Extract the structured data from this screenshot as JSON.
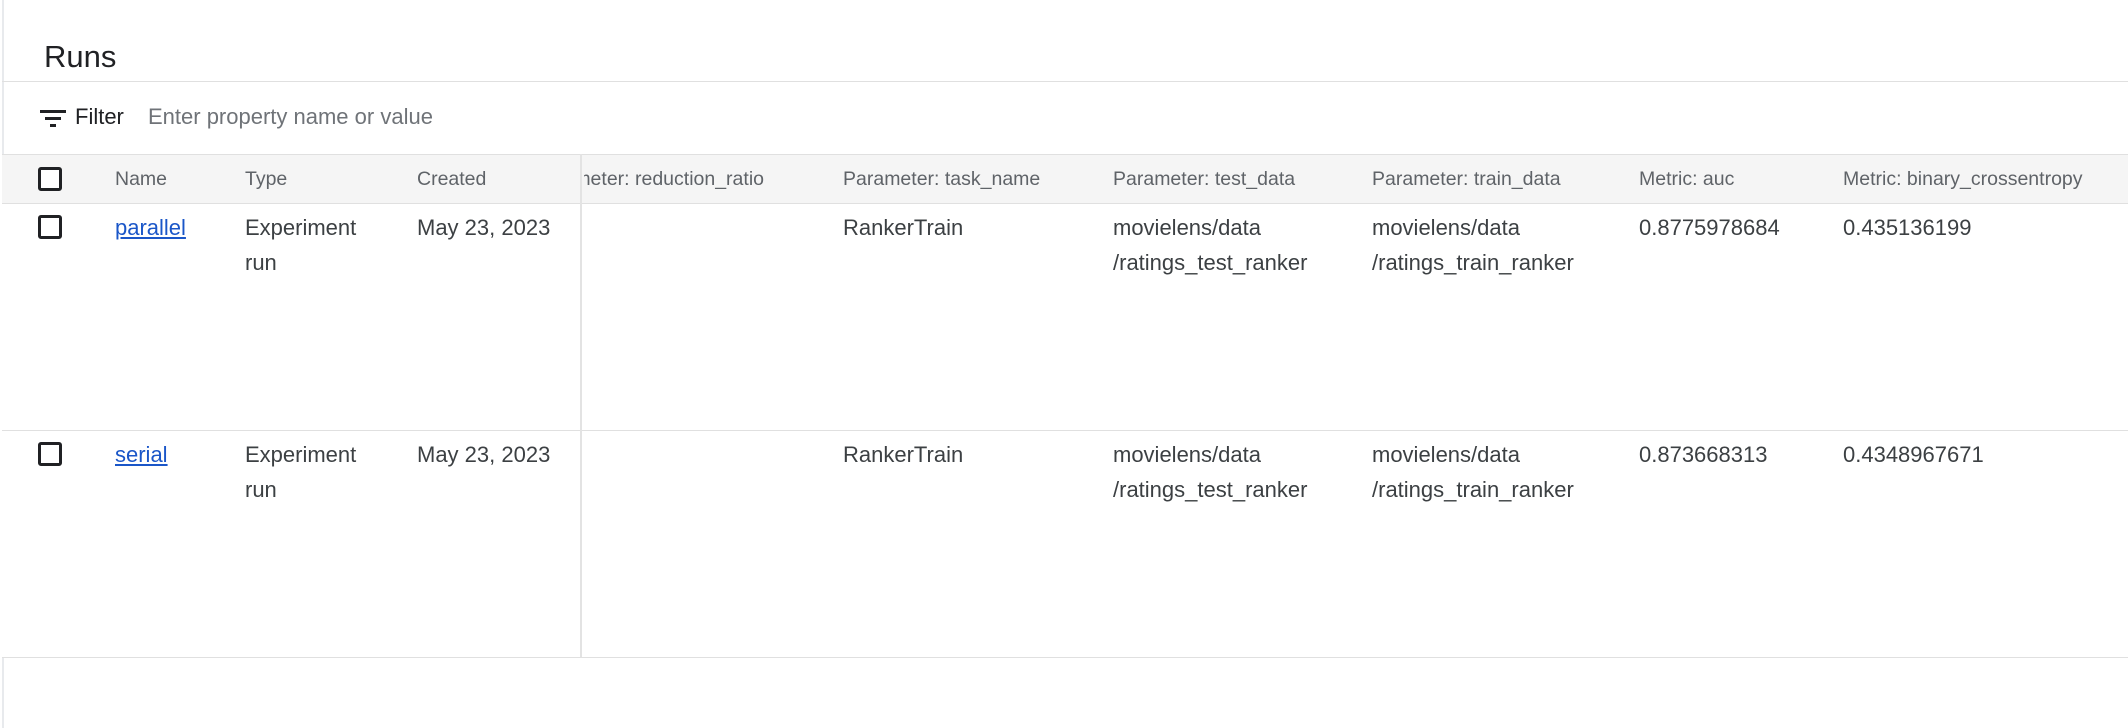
{
  "page": {
    "title": "Runs"
  },
  "filter": {
    "label": "Filter",
    "placeholder": "Enter property name or value",
    "icon": "filter-list-icon"
  },
  "table": {
    "columns": {
      "name": "Name",
      "type": "Type",
      "created": "Created",
      "reduction_ratio": "Parameter: reduction_ratio",
      "task_name": "Parameter: task_name",
      "test_data": "Parameter: test_data",
      "train_data": "Parameter: train_data",
      "auc": "Metric: auc",
      "binary_crossentropy": "Metric: binary_crossentropy"
    },
    "rows": [
      {
        "name": "parallel",
        "type": "Experiment run",
        "created": "May 23, 2023",
        "reduction_ratio": "",
        "task_name": "RankerTrain",
        "test_data": "movielens/data /ratings_test_ranker",
        "train_data": "movielens/data /ratings_train_ranker",
        "auc": "0.8775978684",
        "binary_crossentropy": "0.435136199"
      },
      {
        "name": "serial",
        "type": "Experiment run",
        "created": "May 23, 2023",
        "reduction_ratio": "",
        "task_name": "RankerTrain",
        "test_data": "movielens/data /ratings_test_ranker",
        "train_data": "movielens/data /ratings_train_ranker",
        "auc": "0.873668313",
        "binary_crossentropy": "0.4348967671"
      }
    ]
  }
}
